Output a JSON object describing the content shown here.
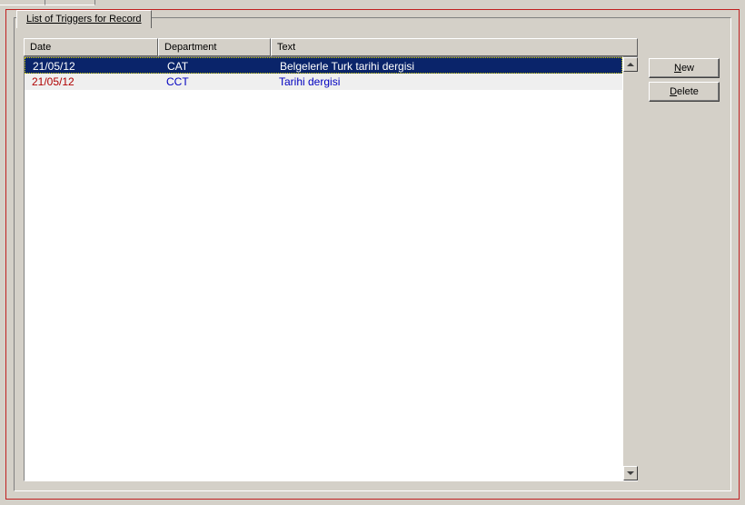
{
  "tab_label": "List of Triggers for Record",
  "columns": {
    "date": "Date",
    "department": "Department",
    "text": "Text"
  },
  "rows": [
    {
      "date": "21/05/12",
      "department": "CAT",
      "text": "Belgelerle Turk tarihi dergisi",
      "selected": true
    },
    {
      "date": "21/05/12",
      "department": "CCT",
      "text": "Tarihi dergisi",
      "selected": false
    }
  ],
  "buttons": {
    "new": "New",
    "delete": "Delete"
  }
}
